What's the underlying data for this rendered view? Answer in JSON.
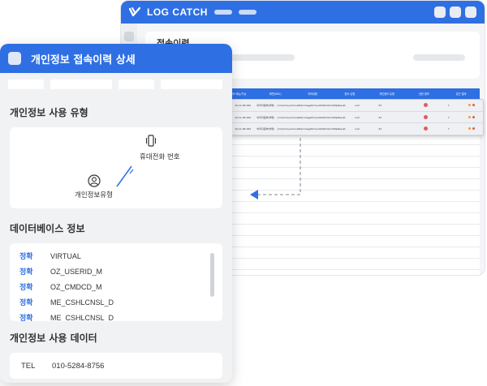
{
  "back_window": {
    "title": "LOG CATCH",
    "header_title": "접속이력",
    "table_columns": [
      "사용자 ID",
      "성명",
      "접속 메뉴/기능",
      "화면(URL)",
      "처리내용",
      "접속 유형",
      "개인정보 유형",
      "권한 정보",
      "접근 결과"
    ],
    "rows": [
      {
        "date": "15.11.28.182",
        "user": "바라지원부(부패)",
        "path": "/cms/cmsu/cmsu002/cmsgetCmsu002DctxCmfIdpReList.spa",
        "method": "null",
        "count": "33",
        "flag": "Y"
      },
      {
        "date": "15.11.28.182",
        "user": "바라지원부(부패)",
        "path": "/cms/cmsu/cmsu002/cmsgetCmsu002DctxCmfIdpReList.spa",
        "method": "null",
        "count": "33",
        "flag": "Y"
      },
      {
        "date": "15.11.28.182",
        "user": "바라지원부(부패)",
        "path": "/cms/cmsu/cmsu002/cmsgetCmsu002DctxCmfIdpReList.spa",
        "method": "null",
        "count": "33",
        "flag": "Y"
      }
    ]
  },
  "panel": {
    "title": "개인정보 접속이력 상세",
    "section_type": "개인정보 사용 유형",
    "device_label": "휴대전화 번호",
    "user_label": "개인정보유형",
    "section_db": "데이터베이스 정보",
    "db_rows": [
      {
        "status": "정확",
        "name": "VIRTUAL"
      },
      {
        "status": "정확",
        "name": "OZ_USERID_M"
      },
      {
        "status": "정확",
        "name": "OZ_CMDCD_M"
      },
      {
        "status": "정확",
        "name": "ME_CSHLCNSL_D"
      },
      {
        "status": "정확",
        "name": "ME_CSHLCNSL_D"
      }
    ],
    "section_data": "개인정보 사용 데이터",
    "data_key": "TEL",
    "data_value": "010-5284-8756"
  },
  "colors": {
    "accent": "#2f6fe4",
    "panel_bg": "#f1f2f4",
    "danger": "#e05b5b"
  },
  "icons": [
    "logo-check-icon",
    "phone-vibrate-icon",
    "user-circle-icon",
    "arrow-left-icon"
  ]
}
